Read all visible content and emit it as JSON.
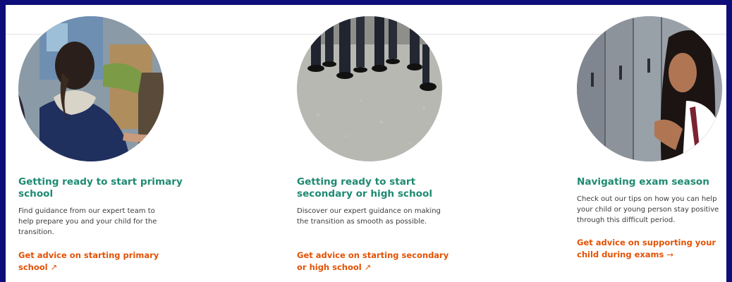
{
  "cards": [
    {
      "title": "Getting ready to start primary school",
      "description": "Find guidance from our expert team to help prepare you and your child for the transition.",
      "link_label": "Get advice on starting primary school",
      "link_icon": "↗",
      "image": "child-in-classroom-photo"
    },
    {
      "title": "Getting ready to start secondary or high school",
      "description": "Discover our expert guidance on making the transition as smooth as possible.",
      "link_label": "Get advice on starting secondary or high school",
      "link_icon": "↗",
      "image": "students-feet-playground-photo"
    },
    {
      "title": "Navigating exam season",
      "description": "Check out our tips on how you can help your child or young person stay positive through this difficult period.",
      "link_label": "Get advice on supporting your child during exams",
      "link_icon": "→",
      "image": "student-by-lockers-photo"
    }
  ],
  "colors": {
    "title": "#1e8a72",
    "link": "#e35205",
    "body_text": "#3b3b3b",
    "page_border": "#0e0e7a"
  }
}
